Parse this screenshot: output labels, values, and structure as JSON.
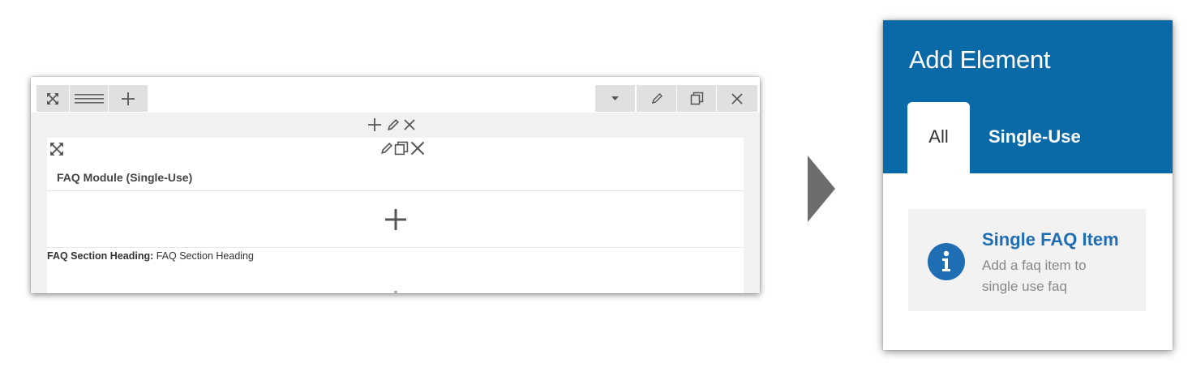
{
  "builder": {
    "toolbar_left": [
      "expand-icon",
      "drag-handle-icon",
      "add-icon"
    ],
    "toolbar_right": [
      "dropdown-caret-icon",
      "edit-pencil-icon",
      "duplicate-icon",
      "close-icon"
    ],
    "module_title": "FAQ Module (Single-Use)",
    "field_label": "FAQ Section Heading:",
    "field_value": " FAQ Section Heading"
  },
  "add_element": {
    "title": "Add Element",
    "tabs": [
      {
        "label": "All",
        "active": true
      },
      {
        "label": "Single-Use",
        "active": false
      }
    ],
    "items": [
      {
        "title": "Single FAQ Item",
        "description": "Add a faq item to single use faq",
        "icon": "info-icon"
      }
    ]
  },
  "colors": {
    "panel_header": "#0a6aa8",
    "accent": "#1f6db3",
    "arrow": "#6d6d6d"
  }
}
